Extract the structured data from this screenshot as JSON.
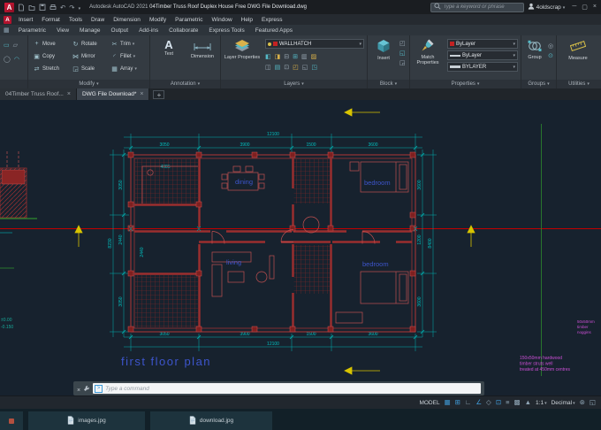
{
  "titlebar": {
    "app_title": "Autodesk AutoCAD 2021",
    "doc_title": "04Timber Truss Roof Duplex House Free DWG File Download.dwg",
    "search_placeholder": "Type a keyword or phrase",
    "account": "4oldscrap"
  },
  "menu": {
    "items": [
      "Insert",
      "Format",
      "Tools",
      "Draw",
      "Dimension",
      "Modify",
      "Parametric",
      "Window",
      "Help",
      "Express"
    ]
  },
  "ribbon_tabs": [
    "Parametric",
    "View",
    "Manage",
    "Output",
    "Add-ins",
    "Collaborate",
    "Express Tools",
    "Featured Apps"
  ],
  "ribbon": {
    "modify": {
      "label": "Modify",
      "tools": [
        "Move",
        "Rotate",
        "Trim",
        "Copy",
        "Mirror",
        "Fillet",
        "Stretch",
        "Scale",
        "Array"
      ]
    },
    "annotation": {
      "label": "Annotation",
      "text_tool": "Text",
      "dimension_tool": "Dimension"
    },
    "layers": {
      "label": "Layers",
      "layer_properties": "Layer Properties",
      "current_layer": "WALLHATCH"
    },
    "block": {
      "label": "Block",
      "insert": "Insert"
    },
    "properties": {
      "label": "Properties",
      "match": "Match Properties",
      "color": "ByLayer",
      "linetype": "ByLayer",
      "lineweight": "BYLAYER"
    },
    "groups": {
      "label": "Groups",
      "group": "Group"
    },
    "utilities": {
      "label": "Utilities",
      "measure": "Measure"
    }
  },
  "file_tabs": {
    "tab1": "04Timber Truss Roof...",
    "tab2": "DWG File Download*"
  },
  "drawing": {
    "labels": {
      "dining": "dining",
      "bedroom_top": "bedroom",
      "living": "living",
      "bedroom_bottom": "bedroom",
      "plan_title": "first floor plan"
    },
    "notes": {
      "magenta_large": [
        "150x50mm hardwood",
        "timber struts well",
        "treated at 450mm centres"
      ],
      "magenta_small": [
        "50x50mm",
        "timber",
        "noggins"
      ],
      "elevation": [
        "±0.00",
        "-0.150"
      ]
    },
    "dims": {
      "overall_top": "12100",
      "t1": "3050",
      "t2": "3900",
      "t3": "1500",
      "t4": "3600",
      "l1": "3050",
      "l2": "2440",
      "l3": "3050",
      "overall_left": "8230",
      "r1": "3600",
      "r2": "1200",
      "r3": "3600",
      "overall_right": "8400",
      "b1": "3050",
      "b2": "3900",
      "b3": "1500",
      "b4": "3600",
      "overall_bottom": "12100",
      "i1": "4085",
      "i2": "2440"
    },
    "colors": {
      "canvas_bg": "#17222e",
      "walls": "#b03535",
      "dimensions": "#00b2b2",
      "room_labels": "#3d55cc",
      "notes": "#cc4fd6",
      "centerline": "#c40000",
      "section_markers": "#d8c400",
      "aux_green": "#2e8b2e"
    }
  },
  "command": {
    "placeholder": "Type a command"
  },
  "statusbar": {
    "model_label": "MODEL",
    "scale": "1:1",
    "units": "Decimal"
  },
  "bottombar": {
    "file1": "images.jpg",
    "file2": "download.jpg"
  },
  "icons": {
    "logo_letter": "A",
    "menu_grid": "▦",
    "move": "+",
    "rotate": "↻",
    "trim": "✂",
    "copy": "▣",
    "mirror": "⋈",
    "fillet": "◜",
    "stretch": "⇄",
    "scale": "◲",
    "array": "▦",
    "text_letter": "A",
    "draw_minis": [
      "▭",
      "▱",
      "◯",
      "◠"
    ],
    "layer_minis": [
      "◧",
      "◨",
      "⊟",
      "⊞",
      "▥",
      "▨",
      "◫",
      "▤",
      "⊡",
      "◰",
      "◱",
      "◳"
    ],
    "block_minis": [
      "◰",
      "◱",
      "◲"
    ],
    "group_minis": [
      "◎",
      "⊙"
    ],
    "grid": "▦",
    "snap": "⊞",
    "ortho": "∟",
    "polar": "∠",
    "iso": "◇",
    "osnap": "⊡",
    "lineweight": "≡",
    "transparency": "▩",
    "annotation": "▲",
    "gear": "⊛",
    "clean": "◱"
  }
}
